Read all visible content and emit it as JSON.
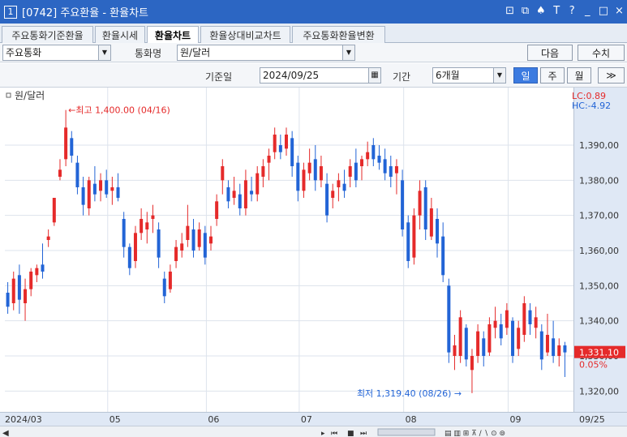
{
  "window": {
    "number": "1",
    "title": "[0742] 주요환율 - 환율차트",
    "icons": [
      "screen-split-icon",
      "window-icon",
      "pin-icon",
      "text-icon",
      "help-icon",
      "minimize-icon",
      "maximize-icon",
      "close-icon"
    ],
    "icon_glyphs": [
      "⊡",
      "⧉",
      "♠",
      "T",
      "?",
      "_",
      "□",
      "×"
    ]
  },
  "tabs": [
    {
      "label": "주요통화기준환율",
      "active": false
    },
    {
      "label": "환율시세",
      "active": false
    },
    {
      "label": "환율차트",
      "active": true
    },
    {
      "label": "환율상대비교차트",
      "active": false
    },
    {
      "label": "주요통화환율변환",
      "active": false
    }
  ],
  "toolbar": {
    "currency_group": "주요통화",
    "currency_name_label": "통화명",
    "currency_name": "원/달러",
    "next_button": "다음",
    "values_button": "수치",
    "base_date_label": "기준일",
    "base_date": "2024/09/25",
    "period_label": "기간",
    "period": "6개월",
    "period_buttons": [
      {
        "label": "일",
        "active": true
      },
      {
        "label": "주",
        "active": false
      },
      {
        "label": "월",
        "active": false
      }
    ],
    "more_button": "≫"
  },
  "chart_data": {
    "type": "candlestick",
    "legend": "원/달러",
    "ylim": [
      1315,
      1405
    ],
    "y_ticks": [
      1320,
      1330,
      1340,
      1350,
      1360,
      1370,
      1380,
      1390
    ],
    "y_tick_labels": [
      "1,320,00",
      "1,330,00",
      "1,340,00",
      "1,350,00",
      "1,360,00",
      "1,370,00",
      "1,380,00",
      "1,390,00"
    ],
    "x_tick_labels": [
      "2024/03",
      "05",
      "06",
      "07",
      "08",
      "09",
      "09/25"
    ],
    "max_annotation": "최고 1,400.00 (04/16)",
    "min_annotation": "최저 1,319.40 (08/26)",
    "lc_label": "LC:0.89",
    "hc_label": "HC:-4.92",
    "last_price": "1,331.10",
    "last_change": "0.05%",
    "colors": {
      "up": "#e52a2a",
      "down": "#2264d6",
      "grid": "#dde3ec"
    },
    "candles": [
      {
        "o": 1348,
        "h": 1351,
        "l": 1342,
        "c": 1344
      },
      {
        "o": 1345,
        "h": 1354,
        "l": 1343,
        "c": 1352
      },
      {
        "o": 1353,
        "h": 1356,
        "l": 1342,
        "c": 1346
      },
      {
        "o": 1345,
        "h": 1352,
        "l": 1340,
        "c": 1349
      },
      {
        "o": 1349,
        "h": 1355,
        "l": 1347,
        "c": 1354
      },
      {
        "o": 1353,
        "h": 1356,
        "l": 1351,
        "c": 1355
      },
      {
        "o": 1356,
        "h": 1362,
        "l": 1352,
        "c": 1354
      },
      {
        "o": 1363,
        "h": 1366,
        "l": 1361,
        "c": 1364
      },
      {
        "o": 1368,
        "h": 1374,
        "l": 1367,
        "c": 1375
      },
      {
        "o": 1381,
        "h": 1386,
        "l": 1380,
        "c": 1383
      },
      {
        "o": 1386,
        "h": 1400,
        "l": 1384,
        "c": 1395
      },
      {
        "o": 1392,
        "h": 1394,
        "l": 1385,
        "c": 1387
      },
      {
        "o": 1385,
        "h": 1387,
        "l": 1376,
        "c": 1378
      },
      {
        "o": 1378,
        "h": 1381,
        "l": 1370,
        "c": 1373
      },
      {
        "o": 1372,
        "h": 1381,
        "l": 1370,
        "c": 1380
      },
      {
        "o": 1379,
        "h": 1384,
        "l": 1374,
        "c": 1376
      },
      {
        "o": 1377,
        "h": 1382,
        "l": 1374,
        "c": 1380
      },
      {
        "o": 1380,
        "h": 1383,
        "l": 1375,
        "c": 1376
      },
      {
        "o": 1377,
        "h": 1381,
        "l": 1373,
        "c": 1378
      },
      {
        "o": 1378,
        "h": 1382,
        "l": 1374,
        "c": 1375
      },
      {
        "o": 1369,
        "h": 1371,
        "l": 1358,
        "c": 1361
      },
      {
        "o": 1361,
        "h": 1362,
        "l": 1353,
        "c": 1355
      },
      {
        "o": 1357,
        "h": 1367,
        "l": 1355,
        "c": 1365
      },
      {
        "o": 1365,
        "h": 1372,
        "l": 1363,
        "c": 1369
      },
      {
        "o": 1366,
        "h": 1371,
        "l": 1362,
        "c": 1368
      },
      {
        "o": 1369,
        "h": 1373,
        "l": 1365,
        "c": 1370
      },
      {
        "o": 1366,
        "h": 1368,
        "l": 1355,
        "c": 1358
      },
      {
        "o": 1352,
        "h": 1354,
        "l": 1345,
        "c": 1347
      },
      {
        "o": 1349,
        "h": 1356,
        "l": 1348,
        "c": 1354
      },
      {
        "o": 1357,
        "h": 1363,
        "l": 1355,
        "c": 1361
      },
      {
        "o": 1360,
        "h": 1365,
        "l": 1358,
        "c": 1362
      },
      {
        "o": 1363,
        "h": 1373,
        "l": 1361,
        "c": 1367
      },
      {
        "o": 1366,
        "h": 1369,
        "l": 1358,
        "c": 1360
      },
      {
        "o": 1361,
        "h": 1368,
        "l": 1360,
        "c": 1366
      },
      {
        "o": 1365,
        "h": 1367,
        "l": 1356,
        "c": 1358
      },
      {
        "o": 1362,
        "h": 1367,
        "l": 1360,
        "c": 1364
      },
      {
        "o": 1369,
        "h": 1376,
        "l": 1367,
        "c": 1374
      },
      {
        "o": 1380,
        "h": 1386,
        "l": 1376,
        "c": 1384
      },
      {
        "o": 1378,
        "h": 1380,
        "l": 1372,
        "c": 1374
      },
      {
        "o": 1375,
        "h": 1381,
        "l": 1373,
        "c": 1377
      },
      {
        "o": 1376,
        "h": 1379,
        "l": 1370,
        "c": 1372
      },
      {
        "o": 1372,
        "h": 1383,
        "l": 1370,
        "c": 1380
      },
      {
        "o": 1377,
        "h": 1381,
        "l": 1374,
        "c": 1376
      },
      {
        "o": 1376,
        "h": 1384,
        "l": 1374,
        "c": 1382
      },
      {
        "o": 1381,
        "h": 1386,
        "l": 1378,
        "c": 1384
      },
      {
        "o": 1385,
        "h": 1389,
        "l": 1380,
        "c": 1387
      },
      {
        "o": 1388,
        "h": 1395,
        "l": 1386,
        "c": 1393
      },
      {
        "o": 1390,
        "h": 1393,
        "l": 1386,
        "c": 1388
      },
      {
        "o": 1389,
        "h": 1395,
        "l": 1387,
        "c": 1393
      },
      {
        "o": 1392,
        "h": 1394,
        "l": 1381,
        "c": 1384
      },
      {
        "o": 1385,
        "h": 1387,
        "l": 1374,
        "c": 1377
      },
      {
        "o": 1377,
        "h": 1385,
        "l": 1375,
        "c": 1383
      },
      {
        "o": 1382,
        "h": 1389,
        "l": 1380,
        "c": 1385
      },
      {
        "o": 1386,
        "h": 1390,
        "l": 1377,
        "c": 1380
      },
      {
        "o": 1380,
        "h": 1387,
        "l": 1378,
        "c": 1384
      },
      {
        "o": 1379,
        "h": 1382,
        "l": 1368,
        "c": 1370
      },
      {
        "o": 1375,
        "h": 1379,
        "l": 1372,
        "c": 1377
      },
      {
        "o": 1378,
        "h": 1382,
        "l": 1374,
        "c": 1380
      },
      {
        "o": 1379,
        "h": 1383,
        "l": 1375,
        "c": 1377
      },
      {
        "o": 1381,
        "h": 1386,
        "l": 1378,
        "c": 1384
      },
      {
        "o": 1385,
        "h": 1389,
        "l": 1378,
        "c": 1380
      },
      {
        "o": 1384,
        "h": 1387,
        "l": 1380,
        "c": 1386
      },
      {
        "o": 1386,
        "h": 1391,
        "l": 1384,
        "c": 1388
      },
      {
        "o": 1390,
        "h": 1392,
        "l": 1384,
        "c": 1386
      },
      {
        "o": 1387,
        "h": 1390,
        "l": 1383,
        "c": 1385
      },
      {
        "o": 1386,
        "h": 1389,
        "l": 1380,
        "c": 1382
      },
      {
        "o": 1384,
        "h": 1387,
        "l": 1378,
        "c": 1381
      },
      {
        "o": 1382,
        "h": 1386,
        "l": 1376,
        "c": 1384
      },
      {
        "o": 1380,
        "h": 1383,
        "l": 1364,
        "c": 1366
      },
      {
        "o": 1368,
        "h": 1370,
        "l": 1355,
        "c": 1357
      },
      {
        "o": 1358,
        "h": 1372,
        "l": 1356,
        "c": 1370
      },
      {
        "o": 1370,
        "h": 1380,
        "l": 1366,
        "c": 1377
      },
      {
        "o": 1378,
        "h": 1380,
        "l": 1363,
        "c": 1366
      },
      {
        "o": 1364,
        "h": 1375,
        "l": 1363,
        "c": 1372
      },
      {
        "o": 1369,
        "h": 1372,
        "l": 1358,
        "c": 1362
      },
      {
        "o": 1364,
        "h": 1368,
        "l": 1351,
        "c": 1353
      },
      {
        "o": 1350,
        "h": 1352,
        "l": 1328,
        "c": 1331
      },
      {
        "o": 1330,
        "h": 1336,
        "l": 1326,
        "c": 1333
      },
      {
        "o": 1330,
        "h": 1343,
        "l": 1328,
        "c": 1341
      },
      {
        "o": 1338,
        "h": 1339,
        "l": 1327,
        "c": 1329
      },
      {
        "o": 1326,
        "h": 1332,
        "l": 1319.4,
        "c": 1330
      },
      {
        "o": 1330,
        "h": 1339,
        "l": 1328,
        "c": 1337
      },
      {
        "o": 1335,
        "h": 1337,
        "l": 1327,
        "c": 1330
      },
      {
        "o": 1331,
        "h": 1341,
        "l": 1330,
        "c": 1339
      },
      {
        "o": 1338,
        "h": 1344,
        "l": 1335,
        "c": 1340
      },
      {
        "o": 1339,
        "h": 1342,
        "l": 1333,
        "c": 1335
      },
      {
        "o": 1338,
        "h": 1345,
        "l": 1336,
        "c": 1343
      },
      {
        "o": 1340,
        "h": 1341,
        "l": 1328,
        "c": 1330
      },
      {
        "o": 1332,
        "h": 1340,
        "l": 1330,
        "c": 1338
      },
      {
        "o": 1336,
        "h": 1347,
        "l": 1334,
        "c": 1345
      },
      {
        "o": 1343,
        "h": 1345,
        "l": 1336,
        "c": 1339
      },
      {
        "o": 1338,
        "h": 1344,
        "l": 1335,
        "c": 1341
      },
      {
        "o": 1337,
        "h": 1339,
        "l": 1326,
        "c": 1329
      },
      {
        "o": 1331,
        "h": 1342,
        "l": 1330,
        "c": 1336
      },
      {
        "o": 1335,
        "h": 1340,
        "l": 1328,
        "c": 1330
      },
      {
        "o": 1330,
        "h": 1335,
        "l": 1327,
        "c": 1333
      },
      {
        "o": 1333,
        "h": 1334,
        "l": 1324,
        "c": 1331
      }
    ]
  }
}
